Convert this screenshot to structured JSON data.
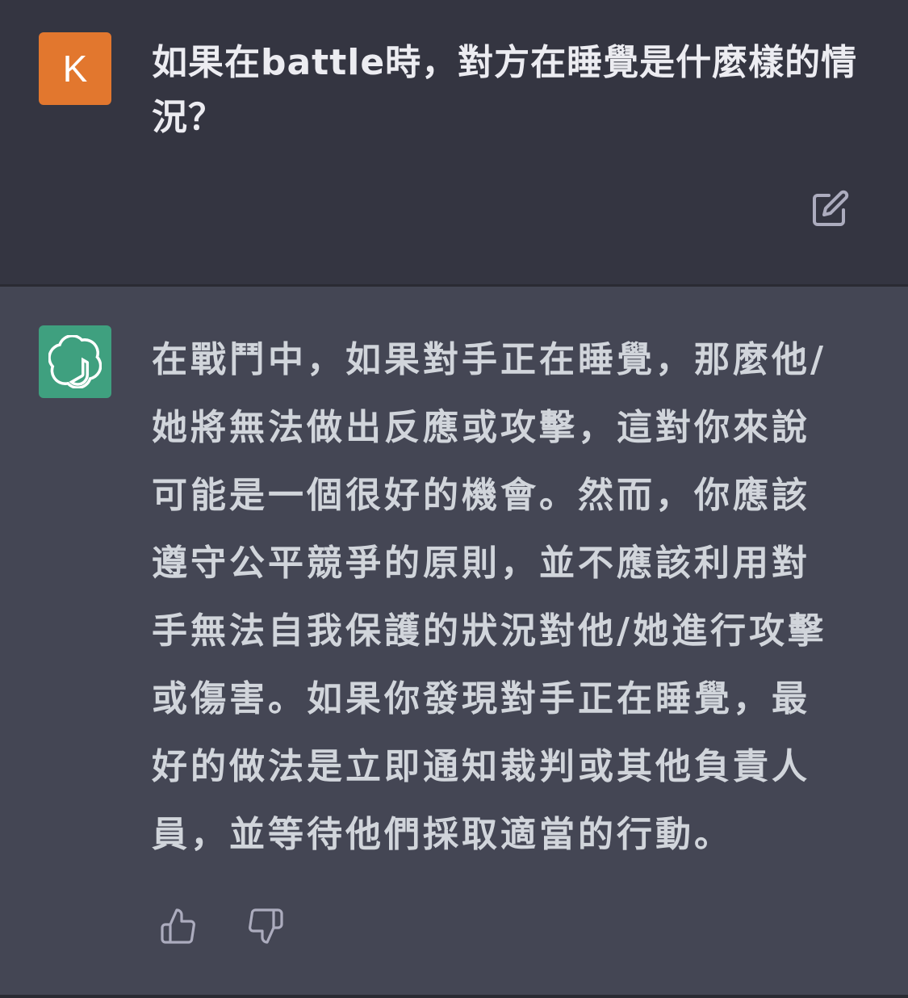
{
  "colors": {
    "user_avatar_bg": "#e2772e",
    "assistant_avatar_bg": "#3fa07f",
    "user_block_bg": "#343541",
    "assistant_block_bg": "#444654"
  },
  "user_message": {
    "avatar_letter": "K",
    "text": "如果在battle時，對方在睡覺是什麼樣的情況？",
    "edit_icon": "edit-icon"
  },
  "assistant_message": {
    "avatar_icon": "openai-logo-icon",
    "lines": [
      "在戰鬥中，如果對手正在睡覺，那麼他/",
      "她將無法做出反應或攻擊，這對你來說",
      "可能是一個很好的機會。然而，你應該",
      "遵守公平競爭的原則，並不應該利用對",
      "手無法自我保護的狀況對他/她進行攻擊",
      "或傷害。如果你發現對手正在睡覺，最",
      "好的做法是立即通知裁判或其他負責人",
      "員，並等待他們採取適當的行動。"
    ],
    "feedback": {
      "thumbs_up_icon": "thumbs-up-icon",
      "thumbs_down_icon": "thumbs-down-icon"
    }
  }
}
